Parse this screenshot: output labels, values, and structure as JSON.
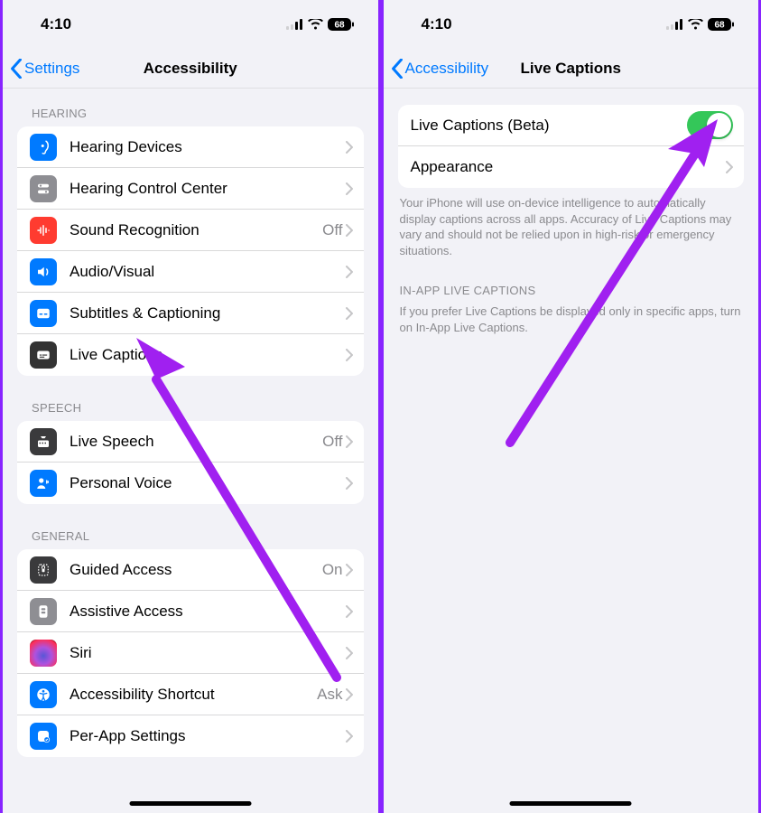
{
  "status": {
    "time": "4:10",
    "battery": "68"
  },
  "left": {
    "back": "Settings",
    "title": "Accessibility",
    "sections": {
      "hearing_header": "HEARING",
      "hearing": [
        {
          "label": "Hearing Devices",
          "detail": ""
        },
        {
          "label": "Hearing Control Center",
          "detail": ""
        },
        {
          "label": "Sound Recognition",
          "detail": "Off"
        },
        {
          "label": "Audio/Visual",
          "detail": ""
        },
        {
          "label": "Subtitles & Captioning",
          "detail": ""
        },
        {
          "label": "Live Captions",
          "detail": ""
        }
      ],
      "speech_header": "SPEECH",
      "speech": [
        {
          "label": "Live Speech",
          "detail": "Off"
        },
        {
          "label": "Personal Voice",
          "detail": ""
        }
      ],
      "general_header": "GENERAL",
      "general": [
        {
          "label": "Guided Access",
          "detail": "On"
        },
        {
          "label": "Assistive Access",
          "detail": ""
        },
        {
          "label": "Siri",
          "detail": ""
        },
        {
          "label": "Accessibility Shortcut",
          "detail": "Ask"
        },
        {
          "label": "Per-App Settings",
          "detail": ""
        }
      ]
    }
  },
  "right": {
    "back": "Accessibility",
    "title": "Live Captions",
    "rows": {
      "toggle": "Live Captions (Beta)",
      "appearance": "Appearance"
    },
    "footer1": "Your iPhone will use on-device intelligence to automatically display captions across all apps. Accuracy of Live Captions may vary and should not be relied upon in high-risk or emergency situations.",
    "inapp_header": "IN-APP LIVE CAPTIONS",
    "footer2": "If you prefer Live Captions be displayed only in specific apps, turn on In-App Live Captions."
  }
}
